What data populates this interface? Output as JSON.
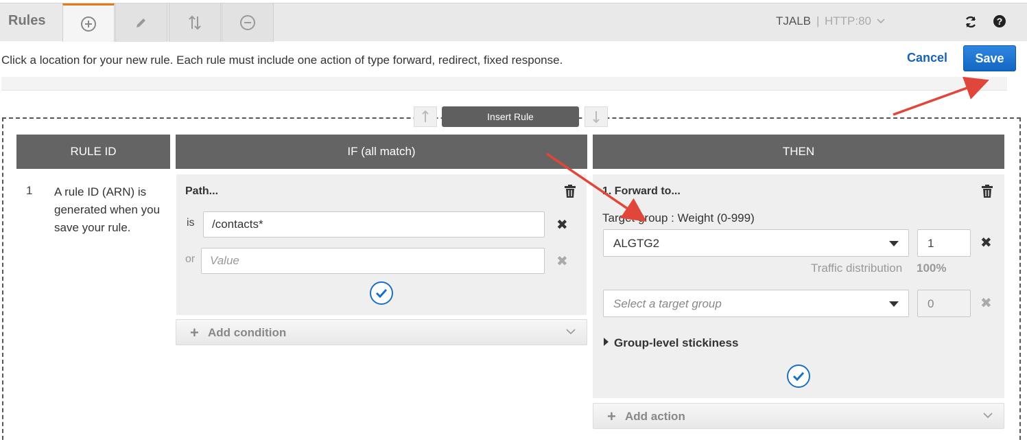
{
  "toolbar": {
    "title": "Rules",
    "load_balancer": "TJALB",
    "separator": "|",
    "listener": "HTTP:80",
    "tabs": [
      {
        "icon": "add-circle-icon",
        "active": true
      },
      {
        "icon": "pencil-icon",
        "active": false
      },
      {
        "icon": "reorder-icon",
        "active": false
      },
      {
        "icon": "remove-circle-icon",
        "active": false
      }
    ]
  },
  "instruction": "Click a location for your new rule. Each rule must include one action of type forward, redirect, fixed response.",
  "actions": {
    "cancel_label": "Cancel",
    "save_label": "Save"
  },
  "insert_rule_label": "Insert Rule",
  "columns": {
    "rule_id": "RULE ID",
    "if": "IF (all match)",
    "then": "THEN"
  },
  "rule": {
    "number": "1",
    "description": "A rule ID (ARN) is generated when you save your rule."
  },
  "condition": {
    "title": "Path...",
    "is_label": "is",
    "is_value": "/contacts*",
    "or_label": "or",
    "or_placeholder": "Value",
    "add_label": "Add condition"
  },
  "action": {
    "title": "1. Forward to...",
    "target_label": "Target group : Weight (0-999)",
    "targets": [
      {
        "group": "ALGTG2",
        "weight": "1"
      },
      {
        "group": "Select a target group",
        "weight": "0"
      }
    ],
    "traffic_label": "Traffic distribution",
    "traffic_value": "100%",
    "stickiness_label": "Group-level stickiness",
    "add_label": "Add action"
  },
  "colors": {
    "accent": "#e07b1b",
    "primary": "#1266c4",
    "header": "#646464",
    "annotation": "#e0463a"
  }
}
